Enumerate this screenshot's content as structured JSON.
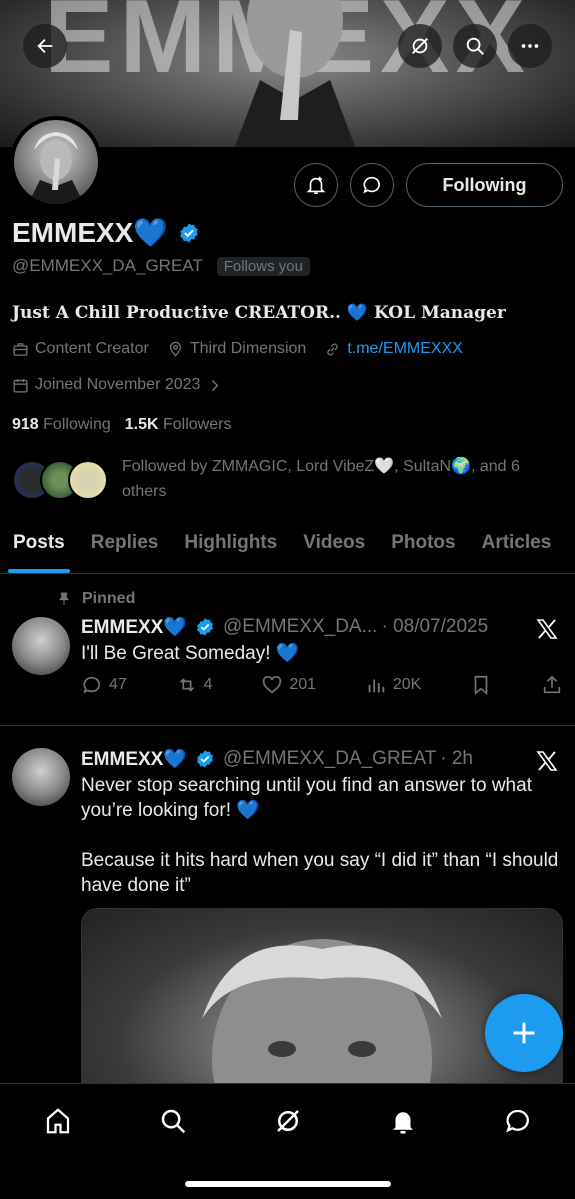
{
  "banner": {
    "text": "EMMEXX"
  },
  "profile": {
    "name": "EMMEXX💙",
    "handle": "@EMMEXX_DA_GREAT",
    "follows_you": "Follows you",
    "follow_button": "Following",
    "bio": "Just A Chill Productive CREATOR.. 💙 KOL Manager",
    "category": "Content Creator",
    "location": "Third Dimension",
    "link": "t.me/EMMEXXX",
    "joined": "Joined November 2023",
    "following_count": "918",
    "following_label": "Following",
    "followers_count": "1.5K",
    "followers_label": "Followers",
    "followed_by": "Followed by ZMMAGIC, Lord VibeZ🤍, SultaN🌍, and 6 others"
  },
  "tabs": [
    "Posts",
    "Replies",
    "Highlights",
    "Videos",
    "Photos",
    "Articles"
  ],
  "posts": [
    {
      "pinned_label": "Pinned",
      "name": "EMMEXX💙",
      "handle": "@EMMEXX_DA...",
      "time": "· 08/07/2025",
      "text": "I'll Be Great Someday! 💙",
      "replies": "47",
      "reposts": "4",
      "likes": "201",
      "views": "20K"
    },
    {
      "name": "EMMEXX💙",
      "handle": "@EMMEXX_DA_GREAT",
      "time": "· 2h",
      "text1": "Never stop searching until you find an answer to what you’re looking for! 💙",
      "text2": "Because it hits hard when you say “I did it” than “I should have done it”"
    }
  ],
  "colors": {
    "accent": "#1d9bf0",
    "muted": "#71767b",
    "border": "#2f3336",
    "text": "#e7e9ea"
  }
}
